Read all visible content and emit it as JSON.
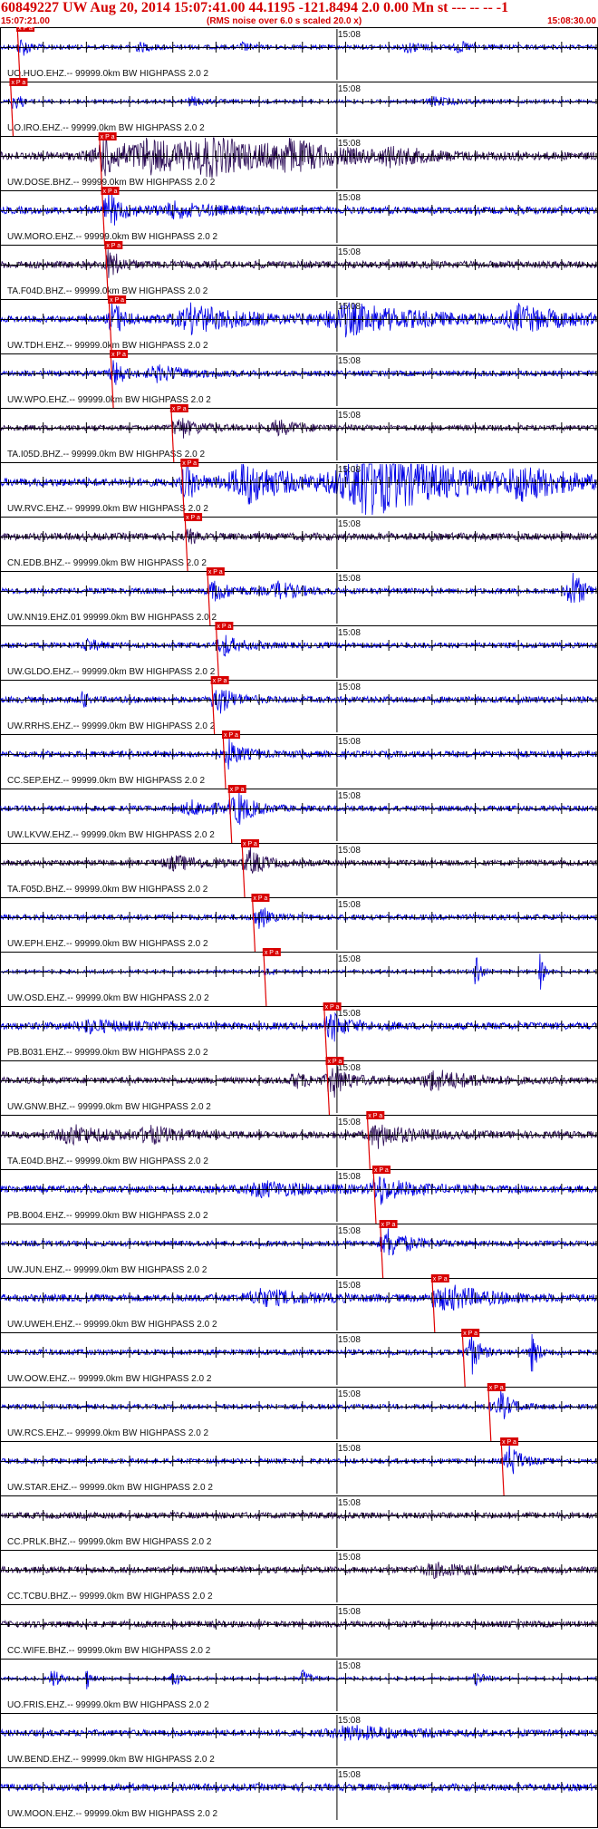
{
  "header": {
    "title": "60849227 UW Aug 20, 2014 15:07:41.00   44.1195 -121.8494  2.0 0.00 Mn st --- -- --  -1",
    "rms_note": "(RMS noise over 6.0 s scaled 20.0 x)",
    "start_time": "15:07:21.00",
    "end_time": "15:08:30.00"
  },
  "chart_data": {
    "type": "line",
    "title": "60849227 UW Aug 20, 2014 15:07:41.00   44.1195 -121.8494  2.0 0.00 Mn st --- -- --  -1",
    "x_unit": "seconds after 15:07:21.00",
    "xlim": [
      0,
      69
    ],
    "minute_mark": {
      "label": "15:08",
      "time": 39
    },
    "pick_label": "x P a",
    "colors": {
      "blue": "#0000e6",
      "purple": "#2a0a55",
      "pick": "#e00000",
      "pick_box": "#d80000"
    },
    "traces": [
      {
        "label": "UO.HUO.EHZ.-- 99999.0km BW  HIGHPASS  2.0  2",
        "color": "blue",
        "amplitude": 0.45,
        "pick": 2.0,
        "events": [
          [
            2.4,
            2.5,
            1.4
          ],
          [
            16.0,
            3.0,
            1.0
          ],
          [
            28.0,
            2.0,
            1.0
          ],
          [
            47.0,
            4.0,
            1.2
          ],
          [
            53.0,
            3.0,
            1.2
          ]
        ]
      },
      {
        "label": "UO.IRO.EHZ.-- 99999.0km BW  HIGHPASS  2.0  2",
        "color": "blue",
        "amplitude": 0.35,
        "pick": 1.2,
        "events": [
          [
            1.5,
            2.0,
            1.4
          ],
          [
            22.0,
            4.0,
            1.0
          ],
          [
            50.0,
            6.0,
            1.0
          ]
        ]
      },
      {
        "label": "UW.DOSE.BHZ.-- 99999.0km BW  HIGHPASS  2.0  2",
        "color": "purple",
        "amplitude": 0.9,
        "pick": 11.5,
        "events": [
          [
            12.0,
            9.0,
            3.0
          ],
          [
            17.0,
            12.0,
            3.0
          ],
          [
            24.0,
            16.0,
            3.5
          ],
          [
            33.0,
            12.0,
            2.5
          ],
          [
            45.0,
            8.0,
            1.4
          ]
        ]
      },
      {
        "label": "UW.MORO.EHZ.-- 99999.0km BW  HIGHPASS  2.0  2",
        "color": "blue",
        "amplitude": 0.8,
        "pick": 11.8,
        "events": [
          [
            12.5,
            5.0,
            2.5
          ],
          [
            20.0,
            10.0,
            1.4
          ]
        ]
      },
      {
        "label": "TA.F04D.BHZ.-- 99999.0km BW  HIGHPASS  2.0  2",
        "color": "purple",
        "amplitude": 0.8,
        "pick": 12.2,
        "events": [
          [
            12.5,
            4.0,
            1.6
          ]
        ]
      },
      {
        "label": "UW.TDH.EHZ.-- 99999.0km BW  HIGHPASS  2.0  2",
        "color": "blue",
        "amplitude": 0.7,
        "pick": 12.6,
        "events": [
          [
            13.0,
            4.0,
            2.5
          ],
          [
            22.0,
            14.0,
            3.0
          ],
          [
            40.0,
            20.0,
            3.2
          ],
          [
            60.0,
            12.0,
            2.5
          ]
        ]
      },
      {
        "label": "UW.WPO.EHZ.-- 99999.0km BW  HIGHPASS  2.0  2",
        "color": "blue",
        "amplitude": 0.6,
        "pick": 12.8,
        "events": [
          [
            13.0,
            3.0,
            2.0
          ],
          [
            18.0,
            8.0,
            1.6
          ]
        ]
      },
      {
        "label": "TA.I05D.BHZ.-- 99999.0km BW  HIGHPASS  2.0  2",
        "color": "purple",
        "amplitude": 0.6,
        "pick": 19.8,
        "events": [
          [
            21.0,
            6.0,
            1.6
          ],
          [
            32.0,
            6.0,
            1.5
          ]
        ]
      },
      {
        "label": "UW.RVC.EHZ.-- 99999.0km BW  HIGHPASS  2.0  2",
        "color": "blue",
        "amplitude": 0.9,
        "pick": 21.0,
        "events": [
          [
            21.5,
            4.0,
            2.5
          ],
          [
            28.0,
            10.0,
            5.0
          ],
          [
            42.0,
            20.0,
            8.0
          ],
          [
            60.0,
            10.0,
            3.0
          ]
        ]
      },
      {
        "label": "CN.EDB.BHZ.-- 99999.0km BW  HIGHPASS  2.0  2",
        "color": "purple",
        "amplitude": 0.8,
        "pick": 21.4,
        "events": []
      },
      {
        "label": "UW.NN19.EHZ.01 99999.0km BW  HIGHPASS  2.0  2",
        "color": "blue",
        "amplitude": 0.6,
        "pick": 24.0,
        "events": [
          [
            25.0,
            6.0,
            1.6
          ],
          [
            32.0,
            6.0,
            1.8
          ],
          [
            66.0,
            3.0,
            5.0
          ]
        ]
      },
      {
        "label": "UW.GLDO.EHZ.-- 99999.0km BW  HIGHPASS  2.0  2",
        "color": "blue",
        "amplitude": 0.6,
        "pick": 25.0,
        "events": [
          [
            26.0,
            5.0,
            1.6
          ],
          [
            10.0,
            3.0,
            1.4
          ]
        ]
      },
      {
        "label": "UW.RRHS.EHZ.-- 99999.0km BW  HIGHPASS  2.0  2",
        "color": "blue",
        "amplitude": 0.7,
        "pick": 24.5,
        "events": [
          [
            25.5,
            4.0,
            2.4
          ],
          [
            9.5,
            1.0,
            2.5
          ]
        ]
      },
      {
        "label": "CC.SEP.EHZ.-- 99999.0km BW  HIGHPASS  2.0  2",
        "color": "blue",
        "amplitude": 0.7,
        "pick": 25.8,
        "events": [
          [
            26.5,
            4.0,
            2.2
          ]
        ]
      },
      {
        "label": "UW.LKVW.EHZ.-- 99999.0km BW  HIGHPASS  2.0  2",
        "color": "blue",
        "amplitude": 0.6,
        "pick": 26.5,
        "events": [
          [
            27.5,
            4.0,
            2.8
          ],
          [
            22.0,
            8.0,
            1.5
          ]
        ]
      },
      {
        "label": "TA.F05D.BHZ.-- 99999.0km BW  HIGHPASS  2.0  2",
        "color": "purple",
        "amplitude": 0.6,
        "pick": 28.0,
        "events": [
          [
            29.0,
            4.0,
            2.2
          ],
          [
            20.0,
            10.0,
            1.4
          ]
        ]
      },
      {
        "label": "UW.EPH.EHZ.-- 99999.0km BW  HIGHPASS  2.0  2",
        "color": "blue",
        "amplitude": 0.6,
        "pick": 29.2,
        "events": [
          [
            30.0,
            3.0,
            1.6
          ]
        ]
      },
      {
        "label": "UW.OSD.EHZ.-- 99999.0km BW  HIGHPASS  2.0  2",
        "color": "blue",
        "amplitude": 0.35,
        "pick": 30.5,
        "events": [
          [
            55.0,
            1.0,
            6.0
          ],
          [
            62.5,
            0.8,
            5.0
          ]
        ]
      },
      {
        "label": "PB.B031.EHZ.-- 99999.0km BW  HIGHPASS  2.0  2",
        "color": "blue",
        "amplitude": 0.8,
        "pick": 37.5,
        "events": [
          [
            38.5,
            5.0,
            2.0
          ],
          [
            10.0,
            10.0,
            1.2
          ]
        ]
      },
      {
        "label": "UW.GNW.BHZ.-- 99999.0km BW  HIGHPASS  2.0  2",
        "color": "purple",
        "amplitude": 0.7,
        "pick": 37.8,
        "events": [
          [
            38.5,
            5.0,
            2.6
          ],
          [
            34.0,
            4.0,
            1.6
          ],
          [
            50.0,
            10.0,
            2.2
          ]
        ]
      },
      {
        "label": "TA.E04D.BHZ.-- 99999.0km BW  HIGHPASS  2.0  2",
        "color": "purple",
        "amplitude": 0.8,
        "pick": 42.5,
        "events": [
          [
            8.0,
            8.0,
            2.0
          ],
          [
            17.0,
            6.0,
            1.8
          ],
          [
            44.0,
            8.0,
            2.0
          ]
        ]
      },
      {
        "label": "PB.B004.EHZ.-- 99999.0km BW  HIGHPASS  2.0  2",
        "color": "blue",
        "amplitude": 0.8,
        "pick": 43.2,
        "events": [
          [
            44.0,
            8.0,
            2.0
          ],
          [
            30.0,
            14.0,
            1.4
          ]
        ]
      },
      {
        "label": "UW.JUN.EHZ.-- 99999.0km BW  HIGHPASS  2.0  2",
        "color": "blue",
        "amplitude": 0.6,
        "pick": 44.0,
        "events": [
          [
            45.0,
            6.0,
            2.6
          ]
        ]
      },
      {
        "label": "UW.UWEH.EHZ.-- 99999.0km BW  HIGHPASS  2.0  2",
        "color": "blue",
        "amplitude": 0.8,
        "pick": 50.0,
        "events": [
          [
            52.0,
            10.0,
            2.4
          ],
          [
            30.0,
            12.0,
            1.6
          ]
        ]
      },
      {
        "label": "UW.OOW.EHZ.-- 99999.0km BW  HIGHPASS  2.0  2",
        "color": "blue",
        "amplitude": 0.6,
        "pick": 53.5,
        "events": [
          [
            54.5,
            2.0,
            4.5
          ],
          [
            61.5,
            1.5,
            4.5
          ]
        ]
      },
      {
        "label": "UW.RCS.EHZ.-- 99999.0km BW  HIGHPASS  2.0  2",
        "color": "blue",
        "amplitude": 0.5,
        "pick": 56.5,
        "events": [
          [
            58.0,
            3.0,
            3.0
          ]
        ]
      },
      {
        "label": "UW.STAR.EHZ.-- 99999.0km BW  HIGHPASS  2.0  2",
        "color": "blue",
        "amplitude": 0.5,
        "pick": 58.0,
        "events": [
          [
            59.0,
            3.0,
            3.5
          ]
        ]
      },
      {
        "label": "CC.PRLK.BHZ.-- 99999.0km BW  HIGHPASS  2.0  2",
        "color": "purple",
        "amplitude": 0.7,
        "pick": null,
        "events": []
      },
      {
        "label": "CC.TCBU.BHZ.-- 99999.0km BW  HIGHPASS  2.0  2",
        "color": "purple",
        "amplitude": 0.7,
        "pick": null,
        "events": [
          [
            50.0,
            10.0,
            1.3
          ]
        ]
      },
      {
        "label": "CC.WIFE.BHZ.-- 99999.0km BW  HIGHPASS  2.0  2",
        "color": "purple",
        "amplitude": 0.7,
        "pick": null,
        "events": []
      },
      {
        "label": "UO.FRIS.EHZ.-- 99999.0km BW  HIGHPASS  2.0  2",
        "color": "blue",
        "amplitude": 0.3,
        "pick": null,
        "events": [
          [
            6.0,
            1.5,
            3.0
          ],
          [
            10.0,
            1.0,
            2.5
          ],
          [
            20.0,
            1.5,
            2.5
          ],
          [
            35.0,
            2.0,
            2.0
          ],
          [
            55.0,
            2.0,
            2.0
          ]
        ]
      },
      {
        "label": "UW.BEND.EHZ.-- 99999.0km BW  HIGHPASS  2.0  2",
        "color": "blue",
        "amplitude": 0.7,
        "pick": null,
        "events": [
          [
            40.0,
            14.0,
            1.4
          ]
        ]
      },
      {
        "label": "UW.MOON.EHZ.-- 99999.0km BW  HIGHPASS  2.0  2",
        "color": "blue",
        "amplitude": 0.8,
        "pick": null,
        "events": []
      }
    ]
  }
}
